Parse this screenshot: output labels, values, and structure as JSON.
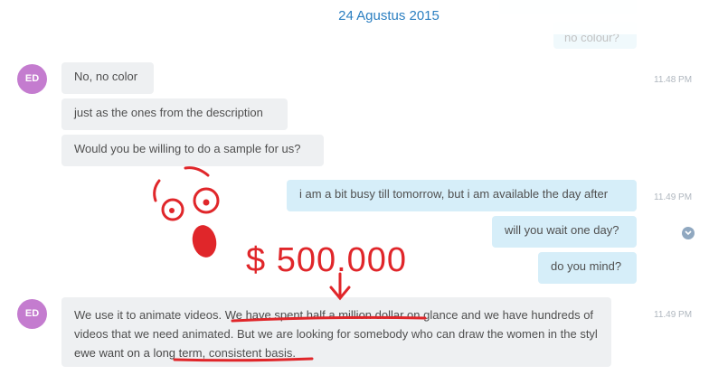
{
  "header": {
    "date": "24 Agustus 2015",
    "faded_prev_text": "no colour?"
  },
  "messages": [
    {
      "sender": "ED",
      "direction": "in",
      "text": "No, no color",
      "time": "11.48 PM"
    },
    {
      "sender": "ED",
      "direction": "in",
      "text": "just as the ones from the description"
    },
    {
      "sender": "ED",
      "direction": "in",
      "text": "Would you be willing to do a sample for us?"
    },
    {
      "sender": "me",
      "direction": "out",
      "text": "i am a bit busy till tomorrow, but i am available the day after",
      "time": "11.49 PM"
    },
    {
      "sender": "me",
      "direction": "out",
      "text": "will you wait one day?"
    },
    {
      "sender": "me",
      "direction": "out",
      "text": "do you mind?"
    },
    {
      "sender": "ED",
      "direction": "in",
      "time": "11.49 PM",
      "parts": [
        "We use it to animate videos. ",
        "We have spent half a million dollar on",
        " glance and we have hundreds of videos that we need animated. But we are looking for somebody who can draw the women in the styl ",
        "ewe want on a long term",
        ", consistent basis."
      ]
    }
  ],
  "annotation": {
    "amount_text": "$ 500.000",
    "color": "#e0262a"
  },
  "colors": {
    "date": "#2b7fc1",
    "avatar": "#c47ccf",
    "incoming_bubble": "#eef0f2",
    "outgoing_bubble": "#d6eef9"
  },
  "icons": {
    "scroll_down": "chevron-down-icon"
  }
}
